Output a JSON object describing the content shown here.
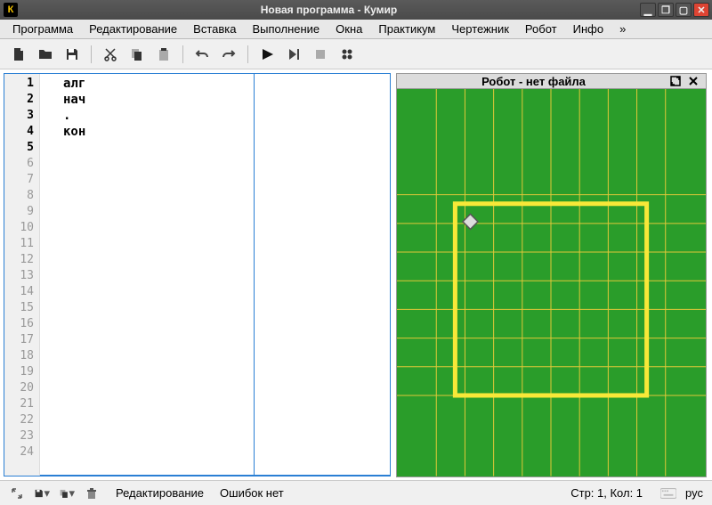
{
  "window": {
    "app_letter": "К",
    "title": "Новая программа - Кумир"
  },
  "menu": {
    "items": [
      "Программа",
      "Редактирование",
      "Вставка",
      "Выполнение",
      "Окна",
      "Практикум",
      "Чертежник",
      "Робот",
      "Инфо",
      "»"
    ]
  },
  "editor": {
    "lines": [
      "алг",
      "нач",
      ".",
      "кон",
      ""
    ],
    "empty_start": 6,
    "empty_end": 24
  },
  "robot_panel": {
    "title": "Робот - нет файла"
  },
  "statusbar": {
    "mode": "Редактирование",
    "errors": "Ошибок нет",
    "position": "Стр: 1, Кол: 1",
    "lang": "рус"
  }
}
